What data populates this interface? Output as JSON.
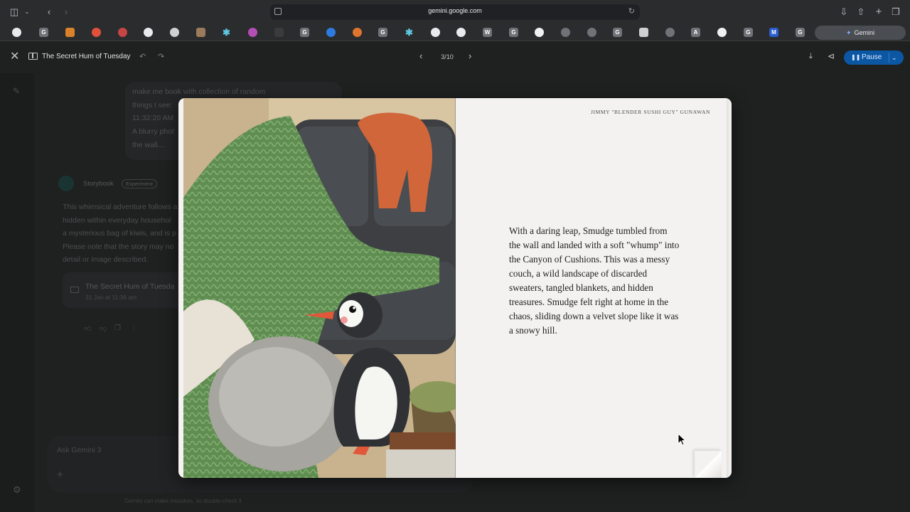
{
  "browser": {
    "url": "gemini.google.com",
    "bookmarks": [
      "G",
      "G",
      "G",
      "G",
      "W",
      "G",
      "G",
      "G",
      "A",
      "G",
      "M",
      "G"
    ],
    "active_tab_label": "Gemini"
  },
  "storybook_header": {
    "title": "The Secret Hum of Tuesday",
    "page_indicator": "3/10",
    "pause_label": "Pause"
  },
  "chat": {
    "user_message_lines": [
      "make me book with collection of random",
      "things I see:",
      "11:32:20 AM",
      "A blurry phot",
      "the wall...."
    ],
    "response_name": "Storybook",
    "response_tag": "Experiment",
    "description_lines": [
      "This whimsical adventure follows a",
      "hidden within everyday househol",
      "a mysterious bag of kiwis, and is p",
      "Please note that the story may no",
      "detail or image described."
    ],
    "card_title": "The Secret Hum of Tuesda",
    "card_date": "31 Jan at 11:36 am",
    "input_placeholder": "Ask Gemini 3",
    "disclaimer": "Gemini can make mistakes, so double-check it"
  },
  "book": {
    "author": "JIMMY \"BLENDER SUSHI GUY\" GUNAWAN",
    "page_text": "With a daring leap, Smudge tumbled from the wall and landed with a soft \"whump\" into the Canyon of Cushions. This was a messy couch, a wild landscape of discarded sweaters, tangled blankets, and hidden treasures. Smudge felt right at home in the chaos, sliding down a velvet slope like it was a snowy hill."
  },
  "colors": {
    "accent_button": "#0b57a3",
    "blanket_green": "#5f8d52",
    "sweater_orange": "#d0663a",
    "couch_gray": "#3d3f42"
  },
  "icons": [
    "sidebar-icon",
    "back-icon",
    "forward-icon",
    "reload-icon",
    "download-icon",
    "share-icon",
    "plus-icon",
    "tabs-icon",
    "close-icon",
    "book-icon",
    "undo-icon",
    "redo-icon",
    "chevron-left-icon",
    "chevron-right-icon",
    "pause-icon",
    "chevron-down-icon",
    "edit-icon",
    "gear-icon",
    "thumbs-up-icon",
    "thumbs-down-icon",
    "copy-icon",
    "more-icon"
  ]
}
